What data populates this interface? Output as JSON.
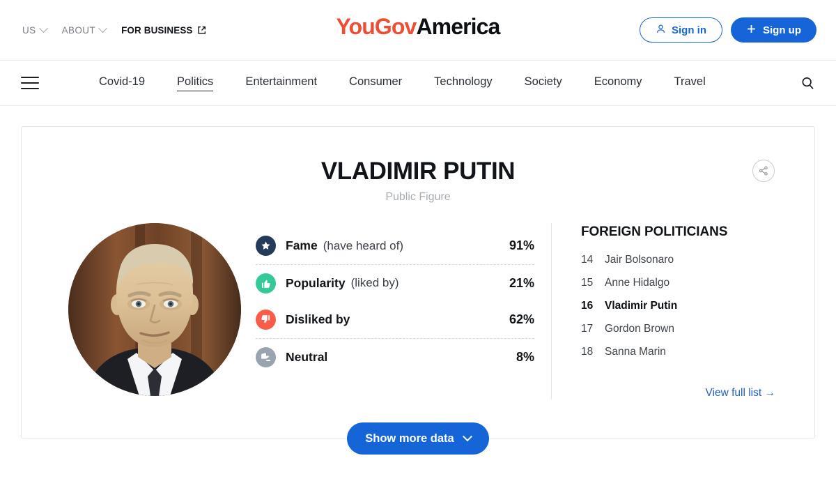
{
  "topbar": {
    "region_label": "US",
    "about_label": "ABOUT",
    "business_label": "FOR BUSINESS",
    "brand_first": "YouGov",
    "brand_second": "America",
    "brand_color": "#ed4e36",
    "signin_label": "Sign in",
    "signup_label": "Sign up",
    "accent_blue": "#1565d8"
  },
  "nav": {
    "items": [
      {
        "label": "Covid-19",
        "active": false
      },
      {
        "label": "Politics",
        "active": true
      },
      {
        "label": "Entertainment",
        "active": false
      },
      {
        "label": "Consumer",
        "active": false
      },
      {
        "label": "Technology",
        "active": false
      },
      {
        "label": "Society",
        "active": false
      },
      {
        "label": "Economy",
        "active": false
      },
      {
        "label": "Travel",
        "active": false
      }
    ]
  },
  "profile": {
    "name": "VLADIMIR PUTIN",
    "category": "Public Figure",
    "portrait_alt": "Vladimir Putin portrait"
  },
  "stats": [
    {
      "label": "Fame",
      "sub": "(have heard of)",
      "value": "91%",
      "icon": "star-icon",
      "color": "#263a5c"
    },
    {
      "label": "Popularity",
      "sub": "(liked by)",
      "value": "21%",
      "icon": "thumbs-up-icon",
      "color": "#35c99a"
    },
    {
      "label": "Disliked by",
      "sub": "",
      "value": "62%",
      "icon": "thumbs-down-icon",
      "color": "#f95d4a"
    },
    {
      "label": "Neutral",
      "sub": "",
      "value": "8%",
      "icon": "thumbs-sideways-icon",
      "color": "#9aa4b0"
    }
  ],
  "ranking": {
    "title": "FOREIGN POLITICIANS",
    "items": [
      {
        "rank": "14",
        "name": "Jair Bolsonaro",
        "current": false
      },
      {
        "rank": "15",
        "name": "Anne Hidalgo",
        "current": false
      },
      {
        "rank": "16",
        "name": "Vladimir Putin",
        "current": true
      },
      {
        "rank": "17",
        "name": "Gordon Brown",
        "current": false
      },
      {
        "rank": "18",
        "name": "Sanna Marin",
        "current": false
      }
    ],
    "view_full_label": "View full list",
    "view_full_arrow": "→"
  },
  "actions": {
    "show_more_label": "Show more data"
  }
}
